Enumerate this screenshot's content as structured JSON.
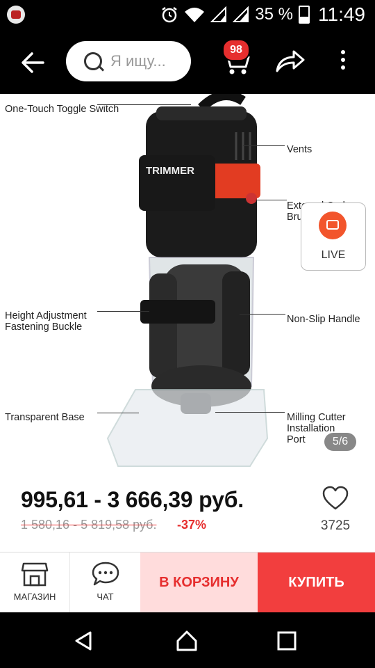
{
  "status_bar": {
    "battery": "35 %",
    "time": "11:49"
  },
  "header": {
    "search_placeholder": "Я ищу...",
    "cart_count": "98"
  },
  "product_image": {
    "labels": {
      "toggle_switch": "One-Touch Toggle Switch",
      "vents": "Vents",
      "carbon_brush": "External Carbon Brush",
      "height_adjust_1": "Height Adjustment",
      "height_adjust_2": "Fastening Buckle",
      "non_slip": "Non-Slip Handle",
      "base": "Transparent Base",
      "cutter_1": "Milling Cutter",
      "cutter_2": "Installation",
      "cutter_3": "Port",
      "brand": "TRIMMER"
    },
    "counter": "5/6",
    "live_label": "LIVE"
  },
  "price": {
    "current": "995,61 - 3 666,39 руб.",
    "original": "1 580,16 - 5 819,58 руб.",
    "discount": "-37%",
    "likes": "3725"
  },
  "actions": {
    "shop_label": "МАГАЗИН",
    "chat_label": "ЧАТ",
    "add_to_cart": "В КОРЗИНУ",
    "buy": "КУПИТЬ"
  },
  "colors": {
    "accent": "#e62e2e",
    "cart_bg": "#ffdcdc",
    "buy_bg": "#f23e3e"
  }
}
